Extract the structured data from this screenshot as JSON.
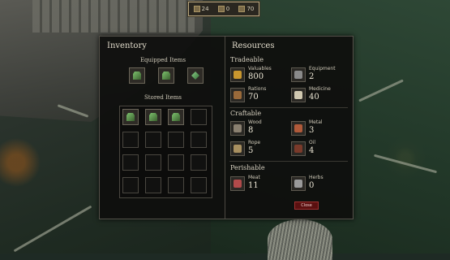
{
  "topbar": {
    "values": [
      "24",
      "0",
      "70"
    ]
  },
  "inventory": {
    "title": "Inventory",
    "equipped_label": "Equipped Items",
    "stored_label": "Stored Items"
  },
  "resources": {
    "title": "Resources",
    "tradeable": {
      "label": "Tradeable",
      "items": [
        {
          "name": "Valuables",
          "value": "800",
          "icon": "valuables-icon",
          "color": "#c8962e"
        },
        {
          "name": "Equipment",
          "value": "2",
          "icon": "equipment-icon",
          "color": "#8a8a8a"
        },
        {
          "name": "Rations",
          "value": "70",
          "icon": "rations-icon",
          "color": "#9a6a3a"
        },
        {
          "name": "Medicine",
          "value": "40",
          "icon": "medicine-icon",
          "color": "#d0c8b0"
        }
      ]
    },
    "craftable": {
      "label": "Craftable",
      "items": [
        {
          "name": "Wood",
          "value": "8",
          "icon": "wood-icon",
          "color": "#8a8070"
        },
        {
          "name": "Metal",
          "value": "3",
          "icon": "metal-icon",
          "color": "#b05a3a"
        },
        {
          "name": "Rope",
          "value": "5",
          "icon": "rope-icon",
          "color": "#a89060"
        },
        {
          "name": "Oil",
          "value": "4",
          "icon": "oil-icon",
          "color": "#7a3a2a"
        }
      ]
    },
    "perishable": {
      "label": "Perishable",
      "items": [
        {
          "name": "Meat",
          "value": "11",
          "icon": "meat-icon",
          "color": "#b04a4a"
        },
        {
          "name": "Herbs",
          "value": "0",
          "icon": "herbs-icon",
          "color": "#9a9a9a"
        }
      ]
    }
  },
  "close_label": "Close"
}
